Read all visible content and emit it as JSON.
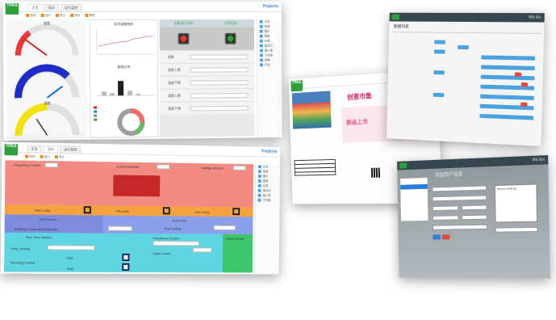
{
  "brand": {
    "logo_text": "TPAS",
    "product": "Projects"
  },
  "app_tabs": [
    "主页",
    "设计",
    "运行监控"
  ],
  "toolbar": [
    "保存",
    "运行",
    "停止",
    "导出",
    "帮助"
  ],
  "right_sidebar": [
    "文本",
    "按钮",
    "图片",
    "图表",
    "仪表",
    "指示灯",
    "输入框",
    "下拉框",
    "表格",
    "开关"
  ],
  "shot1": {
    "gauges": [
      {
        "title": "温度",
        "value_fraction": 0.2,
        "color": "#e53935"
      },
      {
        "title": "",
        "value_fraction": 0.7,
        "color": "#1e2cc7"
      },
      {
        "title": "湿度",
        "value_fraction": 0.45,
        "color": "#f4e114"
      }
    ],
    "charts": [
      {
        "title": "实时温度曲线",
        "type": "line"
      },
      {
        "title": "能耗分布",
        "type": "bar"
      },
      {
        "title": "",
        "type": "donut"
      }
    ],
    "lamps": {
      "headers": [
        "设备运行状态",
        "告警状态"
      ],
      "colors": [
        "#e53935",
        "#2e9f3a"
      ]
    },
    "params": [
      "参数",
      "温度上限",
      "温度下限",
      "湿度上限",
      "湿度下限"
    ]
  },
  "shot2": {
    "top_labels": [
      "Frequency Control",
      "Current Monitor",
      "Voltage Monitor"
    ],
    "mid_labels": [
      "Hold Lamp",
      "Fill Lamp",
      "Line Lamp",
      "Set Current",
      "Hold Time",
      "Stop Dialog",
      "Building Components Monitor",
      "Output Value"
    ],
    "lower_labels": [
      "Run Time Monitor",
      "Frequency Control",
      "Freq. Setting",
      "Run",
      "Stop",
      "Running Control",
      "Cycle Count",
      "Switch Mode"
    ]
  },
  "shot3": {
    "title": "数据列表",
    "header_links": "帮助  退出"
  },
  "shot4": {
    "shop_title": "创意市集",
    "banner_text": "新品上市"
  },
  "shot5": {
    "title": "添加用户信息",
    "box_title": "Device Settings"
  }
}
